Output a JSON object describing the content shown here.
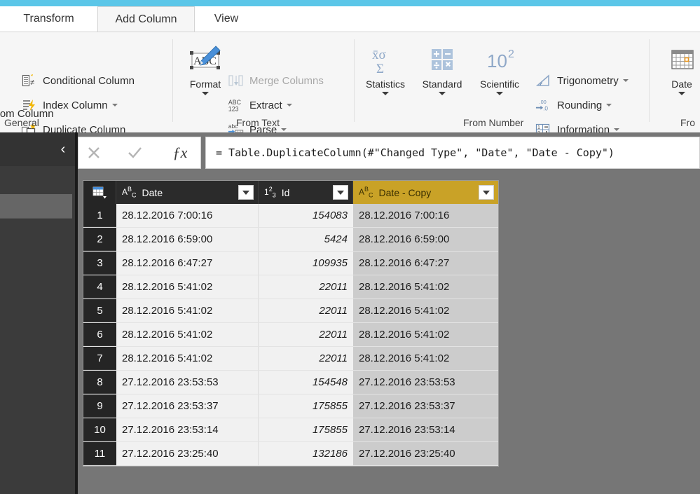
{
  "window": {
    "accent_color": "#5bc6e8",
    "ribbon_bg": "#f6f6f6",
    "selected_column_color": "#c9a227",
    "workspace_bg": "#767676"
  },
  "tabs": [
    {
      "label": "Transform",
      "active": false
    },
    {
      "label": "Add Column",
      "active": true
    },
    {
      "label": "View",
      "active": false
    }
  ],
  "ribbon": {
    "groups": [
      {
        "label": "General",
        "commands": [
          {
            "label": "Custom Column",
            "icon": "custom-column-icon",
            "truncated": true,
            "disabled": false,
            "has_caret": false
          },
          {
            "label": "Conditional Column",
            "icon": "conditional-column-icon",
            "disabled": false,
            "has_caret": false
          },
          {
            "label": "Index Column",
            "icon": "index-column-icon",
            "disabled": false,
            "has_caret": true
          },
          {
            "label": "Duplicate Column",
            "icon": "duplicate-column-icon",
            "disabled": false,
            "has_caret": false
          }
        ]
      },
      {
        "label": "From Text",
        "commands": [
          {
            "label": "Format",
            "icon": "format-abc-icon",
            "disabled": false,
            "has_caret": true
          },
          {
            "label": "Merge Columns",
            "icon": "merge-columns-icon",
            "disabled": true,
            "has_caret": false
          },
          {
            "label": "Extract",
            "icon": "abc123-icon",
            "disabled": false,
            "has_caret": true
          },
          {
            "label": "Parse",
            "icon": "parse-abc-icon",
            "disabled": false,
            "has_caret": true
          }
        ]
      },
      {
        "label": "From Number",
        "commands": [
          {
            "label": "Statistics",
            "icon": "statistics-sigma-icon",
            "disabled": false,
            "has_caret": true
          },
          {
            "label": "Standard",
            "icon": "standard-operators-icon",
            "disabled": false,
            "has_caret": true
          },
          {
            "label": "Scientific",
            "icon": "scientific-power-icon",
            "disabled": false,
            "has_caret": true
          },
          {
            "label": "Trigonometry",
            "icon": "trigonometry-icon",
            "disabled": false,
            "has_caret": true
          },
          {
            "label": "Rounding",
            "icon": "rounding-icon",
            "disabled": false,
            "has_caret": true
          },
          {
            "label": "Information",
            "icon": "information-icon",
            "disabled": false,
            "has_caret": true
          }
        ]
      },
      {
        "label": "Fro",
        "label_truncated": true,
        "commands": [
          {
            "label": "Date",
            "icon": "calendar-date-icon",
            "disabled": false,
            "has_caret": true
          }
        ]
      }
    ]
  },
  "left_pane": {
    "collapse_icon": "chevron-left-icon",
    "collapse_glyph": "‹"
  },
  "formula_bar": {
    "cancel_icon": "cancel-x-icon",
    "confirm_icon": "confirm-check-icon",
    "fx_icon": "fx-icon",
    "fx_glyph": "ƒx",
    "formula": "= Table.DuplicateColumn(#\"Changed Type\", \"Date\", \"Date - Copy\")"
  },
  "grid": {
    "select_all_icon": "select-all-table-icon",
    "columns": [
      {
        "name": "Date",
        "type_icon": "abc-text-type-icon",
        "type": "text",
        "selected": false
      },
      {
        "name": "Id",
        "type_icon": "123-number-type-icon",
        "type": "number",
        "selected": false
      },
      {
        "name": "Date - Copy",
        "type_icon": "abc-text-type-icon",
        "type": "text",
        "selected": true
      }
    ],
    "rows": [
      {
        "n": "1",
        "date": "28.12.2016 7:00:16",
        "id": "154083",
        "copy": "28.12.2016 7:00:16"
      },
      {
        "n": "2",
        "date": "28.12.2016 6:59:00",
        "id": "5424",
        "copy": "28.12.2016 6:59:00"
      },
      {
        "n": "3",
        "date": "28.12.2016 6:47:27",
        "id": "109935",
        "copy": "28.12.2016 6:47:27"
      },
      {
        "n": "4",
        "date": "28.12.2016 5:41:02",
        "id": "22011",
        "copy": "28.12.2016 5:41:02"
      },
      {
        "n": "5",
        "date": "28.12.2016 5:41:02",
        "id": "22011",
        "copy": "28.12.2016 5:41:02"
      },
      {
        "n": "6",
        "date": "28.12.2016 5:41:02",
        "id": "22011",
        "copy": "28.12.2016 5:41:02"
      },
      {
        "n": "7",
        "date": "28.12.2016 5:41:02",
        "id": "22011",
        "copy": "28.12.2016 5:41:02"
      },
      {
        "n": "8",
        "date": "27.12.2016 23:53:53",
        "id": "154548",
        "copy": "27.12.2016 23:53:53"
      },
      {
        "n": "9",
        "date": "27.12.2016 23:53:37",
        "id": "175855",
        "copy": "27.12.2016 23:53:37"
      },
      {
        "n": "10",
        "date": "27.12.2016 23:53:14",
        "id": "175855",
        "copy": "27.12.2016 23:53:14"
      },
      {
        "n": "11",
        "date": "27.12.2016 23:25:40",
        "id": "132186",
        "copy": "27.12.2016 23:25:40"
      }
    ]
  }
}
